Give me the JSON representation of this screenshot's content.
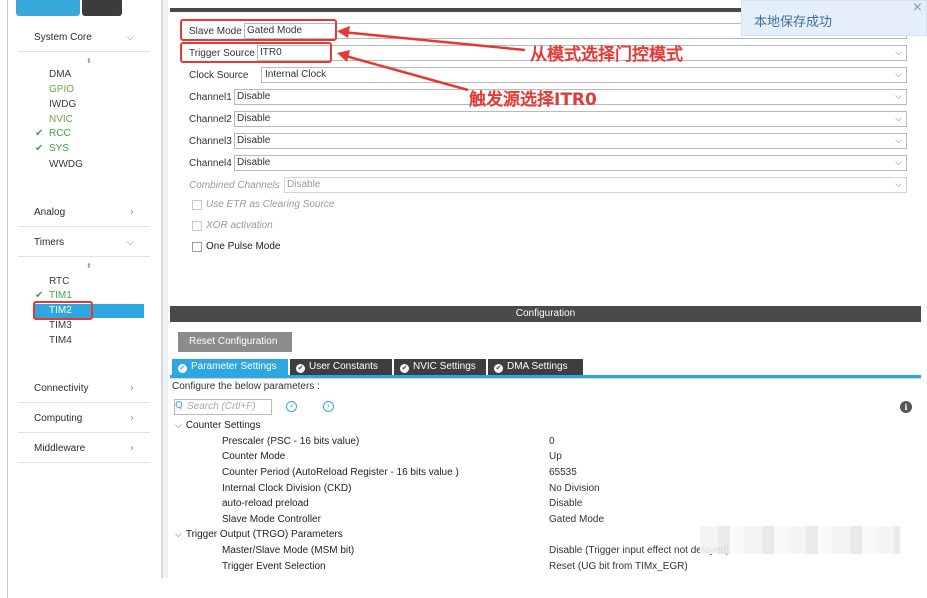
{
  "sidebar": {
    "categories": {
      "system_core": {
        "label": "System Core",
        "chevron": "⌵"
      },
      "analog": {
        "label": "Analog",
        "chevron": "›"
      },
      "timers": {
        "label": "Timers",
        "chevron": "⌵"
      },
      "connectivity": {
        "label": "Connectivity",
        "chevron": "›"
      },
      "computing": {
        "label": "Computing",
        "chevron": "›"
      },
      "middleware": {
        "label": "Middleware",
        "chevron": "›"
      }
    },
    "system_core_items": [
      "DMA",
      "GPIO",
      "IWDG",
      "NVIC",
      "RCC",
      "SYS",
      "WWDG"
    ],
    "timer_items": [
      "RTC",
      "TIM1",
      "TIM2",
      "TIM3",
      "TIM4"
    ],
    "check_glyph": "✔",
    "sort_glyph": "⬍"
  },
  "mode": {
    "slave_mode": {
      "label": "Slave Mode",
      "value": "Gated Mode"
    },
    "trigger_source": {
      "label": "Trigger Source",
      "value": "ITR0"
    },
    "clock_source": {
      "label": "Clock Source",
      "value": "Internal Clock"
    },
    "channel1": {
      "label": "Channel1",
      "value": "Disable"
    },
    "channel2": {
      "label": "Channel2",
      "value": "Disable"
    },
    "channel3": {
      "label": "Channel3",
      "value": "Disable"
    },
    "channel4": {
      "label": "Channel4",
      "value": "Disable"
    },
    "combined_channels": {
      "label": "Combined Channels",
      "value": "Disable"
    },
    "use_etr": "Use ETR as Clearing Source",
    "xor_activation": "XOR activation",
    "one_pulse": "One Pulse Mode",
    "arrow": "⌵"
  },
  "annotations": {
    "slave_mode_note": "从模式选择门控模式",
    "trigger_note": "触发源选择ITR0"
  },
  "configuration": {
    "title": "Configuration",
    "reset_button": "Reset Configuration",
    "tabs": [
      "Parameter Settings",
      "User Constants",
      "NVIC Settings",
      "DMA Settings"
    ],
    "tab_check": "✔",
    "configure_text": "Configure the below parameters :",
    "search_placeholder": "Search (Crtl+F)",
    "search_glyph": "Q",
    "prev_glyph": "‹",
    "next_glyph": "›",
    "info_glyph": "i",
    "caret": "⌵"
  },
  "params": {
    "counter_settings": {
      "title": "Counter Settings",
      "rows": [
        {
          "name": "Prescaler (PSC - 16 bits value)",
          "value": "0"
        },
        {
          "name": "Counter Mode",
          "value": "Up"
        },
        {
          "name": "Counter Period (AutoReload Register - 16 bits value )",
          "value": "65535"
        },
        {
          "name": "Internal Clock Division (CKD)",
          "value": "No Division"
        },
        {
          "name": "auto-reload preload",
          "value": "Disable"
        },
        {
          "name": "Slave Mode Controller",
          "value": "Gated Mode"
        }
      ]
    },
    "trgo": {
      "title": "Trigger Output (TRGO) Parameters",
      "rows": [
        {
          "name": "Master/Slave Mode (MSM bit)",
          "value": "Disable (Trigger input effect not delayed)"
        },
        {
          "name": "Trigger Event Selection",
          "value": "Reset (UG bit from TIMx_EGR)"
        }
      ]
    }
  },
  "toast": {
    "text": "本地保存成功",
    "close": "×"
  }
}
